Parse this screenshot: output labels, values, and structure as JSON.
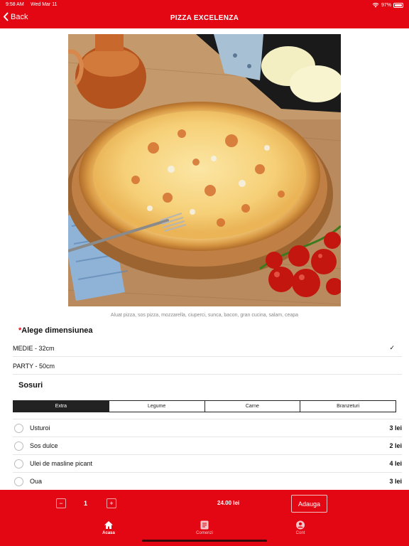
{
  "status": {
    "time": "9:58 AM",
    "date": "Wed Mar 11",
    "battery": "97%",
    "battery_level": 0.97
  },
  "nav": {
    "back_label": "Back",
    "title": "PIZZA EXCELENZA"
  },
  "product": {
    "image": "pizza-photo",
    "ingredients": "Aluat pizza, sos pizza, mozzarella, ciuperci, sunca, bacon, gran cucina, salam, ceapa"
  },
  "size": {
    "required_mark": "*",
    "title": "Alege dimensiunea",
    "options": [
      {
        "label": "MEDIE - 32cm",
        "selected": true
      },
      {
        "label": "PARTY - 50cm",
        "selected": false
      }
    ]
  },
  "sauces": {
    "title": "Sosuri",
    "tabs": [
      "Extra",
      "Legume",
      "Carne",
      "Branzeturi"
    ],
    "active_tab": "Extra",
    "items": [
      {
        "name": "Usturoi",
        "price": "3 lei"
      },
      {
        "name": "Sos dulce",
        "price": "2 lei"
      },
      {
        "name": "Ulei de masline picant",
        "price": "4 lei"
      },
      {
        "name": "Oua",
        "price": "3 lei"
      }
    ]
  },
  "order": {
    "minus": "−",
    "quantity": "1",
    "plus": "+",
    "total": "24.00 lei",
    "add_label": "Adauga"
  },
  "tabbar": {
    "items": [
      {
        "label": "Acasa",
        "icon": "home-icon",
        "active": true
      },
      {
        "label": "Comenzi",
        "icon": "orders-icon",
        "active": false
      },
      {
        "label": "Cont",
        "icon": "account-icon",
        "active": false
      }
    ]
  },
  "colors": {
    "brand": "#e30613",
    "tab_active": "#222222"
  }
}
